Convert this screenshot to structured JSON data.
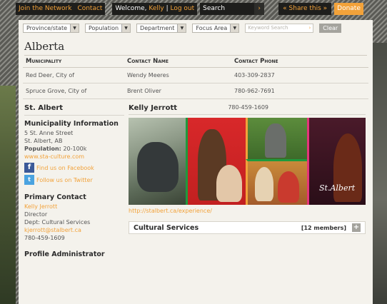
{
  "nav": {
    "join": "Join the Network",
    "contact": "Contact",
    "welcome": "Welcome,",
    "user": "Kelly",
    "logout": "Log out",
    "search_placeholder": "Search",
    "share": "« Share this »",
    "donate": "Donate"
  },
  "filters": {
    "province": "Province/state",
    "population": "Population",
    "department": "Department",
    "focus": "Focus Area",
    "keyword_placeholder": "Keyword Search",
    "clear": "Clear"
  },
  "region": "Alberta",
  "table": {
    "headers": [
      "Municipality",
      "Contact Name",
      "Contact Phone"
    ],
    "rows": [
      [
        "Red Deer, City of",
        "Wendy Meeres",
        "403-309-2837"
      ],
      [
        "Spruce Grove, City of",
        "Brent Oliver",
        "780-962-7691"
      ]
    ]
  },
  "city": {
    "name": "St. Albert",
    "contact_name": "Kelly Jerrott",
    "contact_phone": "780-459-1609",
    "info_heading": "Municipality Information",
    "address1": "5 St. Anne Street",
    "address2": "St. Albert, AB",
    "population_label": "Population:",
    "population_value": "20-100k",
    "website": "www.sta-culture.com",
    "facebook": "Find us on Facebook",
    "twitter": "Follow us on Twitter",
    "primary_heading": "Primary Contact",
    "primary_name": "Kelly Jerrott",
    "primary_title": "Director",
    "primary_dept": "Dept: Cultural Services",
    "primary_email": "kjerrott@stalbert.ca",
    "primary_phone": "780-459-1609",
    "admin_heading": "Profile Administrator",
    "image_link": "http://stalbert.ca/experience/",
    "logo_text": "St.Albert",
    "services_title": "Cultural Services",
    "services_members": "[12 members]"
  }
}
